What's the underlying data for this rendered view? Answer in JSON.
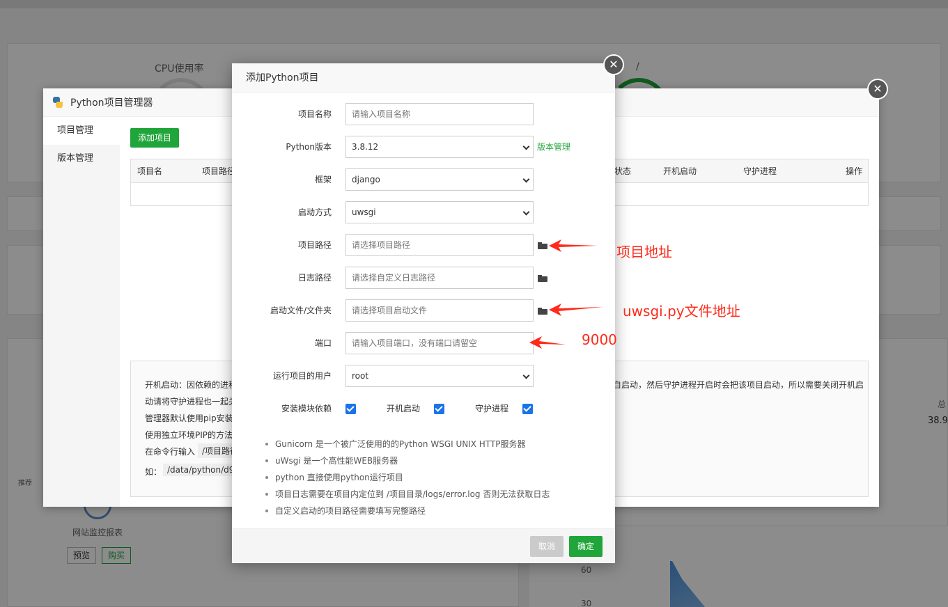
{
  "background": {
    "cpu_label": "CPU使用率",
    "slash": "/",
    "recommend": "推荐",
    "site_report": "网站监控报表",
    "preview_btn": "预览",
    "buy_btn": "购买",
    "total_label": "总",
    "total_value": "38.9",
    "chart_ticks": [
      "60",
      "30"
    ]
  },
  "manager": {
    "title": "Python项目管理器",
    "sidebar": [
      {
        "label": "项目管理",
        "active": true
      },
      {
        "label": "版本管理",
        "active": false
      }
    ],
    "add_button": "添加项目",
    "columns": [
      "项目名",
      "项目路径",
      "状态",
      "开机启动",
      "守护进程",
      "操作"
    ],
    "tips": [
      "开机启动：因依赖的进程",
      "动请将守护进程也一起关",
      "管理器默认使用pip安装",
      "使用独立环境PIP的方法",
      "在命令行输入",
      "如："
    ],
    "tip_codes": [
      "/项目路径",
      "/data/python/d9"
    ],
    "tips_right": [
      "自启动，然后守护进程开启时会把该项目启动，所以需要关闭开机启"
    ]
  },
  "dialog": {
    "title": "添加Python项目",
    "fields": {
      "name": {
        "label": "项目名称",
        "placeholder": "请输入项目名称"
      },
      "python_version": {
        "label": "Python版本",
        "value": "3.8.12",
        "link": "版本管理"
      },
      "framework": {
        "label": "框架",
        "value": "django"
      },
      "start_mode": {
        "label": "启动方式",
        "value": "uwsgi"
      },
      "project_path": {
        "label": "项目路径",
        "placeholder": "请选择项目路径"
      },
      "log_path": {
        "label": "日志路径",
        "placeholder": "请选择自定义日志路径"
      },
      "start_file": {
        "label": "启动文件/文件夹",
        "placeholder": "请选择项目启动文件"
      },
      "port": {
        "label": "端口",
        "placeholder": "请输入项目端口，没有端口请留空"
      },
      "run_user": {
        "label": "运行项目的用户",
        "value": "root"
      }
    },
    "checkboxes": [
      {
        "label": "安装模块依赖",
        "checked": true
      },
      {
        "label": "开机启动",
        "checked": true
      },
      {
        "label": "守护进程",
        "checked": true
      }
    ],
    "notes": [
      "Gunicorn 是一个被广泛使用的的Python WSGI UNIX HTTP服务器",
      "uWsgi 是一个高性能WEB服务器",
      "python 直接使用python运行项目",
      "项目日志需要在项目内定位到 /项目目录/logs/error.log 否则无法获取日志",
      "自定义启动的项目路径需要填写完整路径"
    ],
    "cancel": "取消",
    "confirm": "确定"
  },
  "annotations": {
    "project_addr": "项目地址",
    "uwsgi_addr": "uwsgi.py文件地址",
    "port_value": "9000",
    "color": "#ff2a1a"
  },
  "colors": {
    "accent_green": "#20a53a",
    "checkbox_blue": "#1a73e8"
  }
}
